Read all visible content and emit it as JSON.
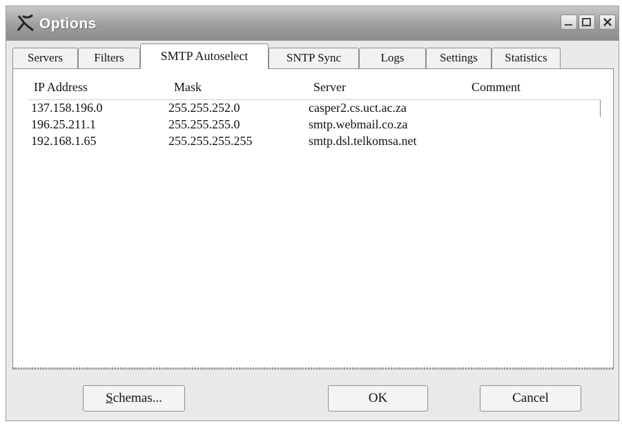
{
  "window": {
    "title": "Options"
  },
  "tabs": [
    {
      "label": "Servers"
    },
    {
      "label": "Filters"
    },
    {
      "label": "SMTP Autoselect"
    },
    {
      "label": "SNTP Sync"
    },
    {
      "label": "Logs"
    },
    {
      "label": "Settings"
    },
    {
      "label": "Statistics"
    }
  ],
  "active_tab": "SMTP Autoselect",
  "list": {
    "columns": [
      "IP Address",
      "Mask",
      "Server",
      "Comment"
    ],
    "rows": [
      {
        "ip": "137.158.196.0",
        "mask": "255.255.252.0",
        "server": "casper2.cs.uct.ac.za",
        "comment": ""
      },
      {
        "ip": "196.25.211.1",
        "mask": "255.255.255.0",
        "server": "smtp.webmail.co.za",
        "comment": ""
      },
      {
        "ip": "192.168.1.65",
        "mask": "255.255.255.255",
        "server": "smtp.dsl.telkomsa.net",
        "comment": ""
      }
    ]
  },
  "buttons": {
    "schemas_first": "S",
    "schemas_rest": "chemas...",
    "ok": "OK",
    "cancel": "Cancel"
  }
}
